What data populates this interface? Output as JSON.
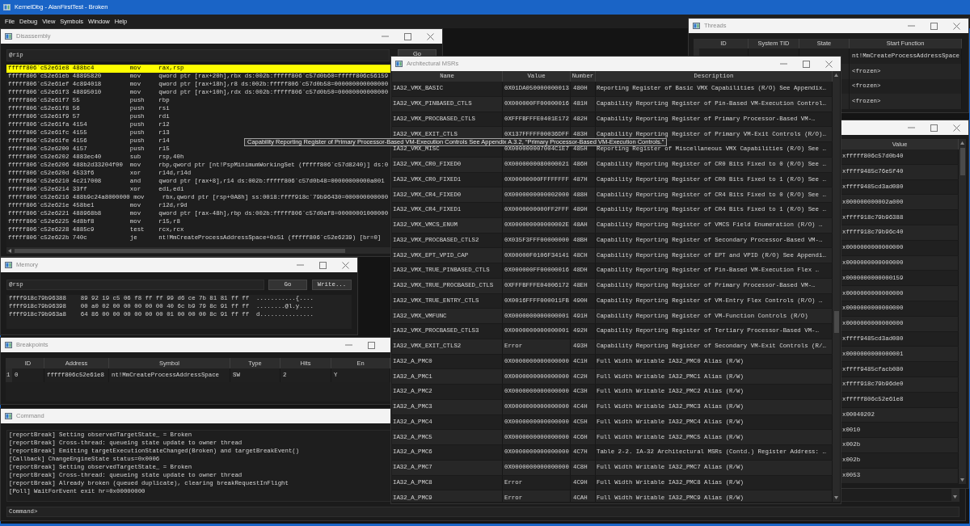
{
  "window": {
    "title": "KernelDbg - AlanFirstTest - Broken"
  },
  "menu": [
    "File",
    "Debug",
    "View",
    "Symbols",
    "Window",
    "Help"
  ],
  "disassembly": {
    "title": "Disassembly",
    "address": "@rip",
    "go_button": "Go",
    "lines": [
      {
        "address": "fffff806`c52e61e8",
        "opcode": "488bc4",
        "mnemonic": "mov",
        "operands": "rax,rsp",
        "current": true
      },
      {
        "address": "fffff806`c52e61eb",
        "opcode": "48895820",
        "mnemonic": "mov",
        "operands": "qword ptr [rax+20h],rbx ds:002b:fffff806`c57d0b60=fffff806c56159",
        "current": false
      },
      {
        "address": "fffff806`c52e61ef",
        "opcode": "4c894018",
        "mnemonic": "mov",
        "operands": "qword ptr [rax+18h],r8 ds:002b:fffff806`c57d0b58=000000000000000",
        "current": false
      },
      {
        "address": "fffff806`c52e61f3",
        "opcode": "48895010",
        "mnemonic": "mov",
        "operands": "qword ptr [rax+10h],rdx ds:002b:fffff806`c57d0b50=00000000000000",
        "current": false
      },
      {
        "address": "fffff806`c52e61f7",
        "opcode": "55",
        "mnemonic": "push",
        "operands": "rbp",
        "current": false
      },
      {
        "address": "fffff806`c52e61f8",
        "opcode": "56",
        "mnemonic": "push",
        "operands": "rsi",
        "current": false
      },
      {
        "address": "fffff806`c52e61f9",
        "opcode": "57",
        "mnemonic": "push",
        "operands": "rdi",
        "current": false
      },
      {
        "address": "fffff806`c52e61fa",
        "opcode": "4154",
        "mnemonic": "push",
        "operands": "r12",
        "current": false
      },
      {
        "address": "fffff806`c52e61fc",
        "opcode": "4155",
        "mnemonic": "push",
        "operands": "r13",
        "current": false
      },
      {
        "address": "fffff806`c52e61fe",
        "opcode": "4156",
        "mnemonic": "push",
        "operands": "r14",
        "current": false
      },
      {
        "address": "fffff806`c52e6200",
        "opcode": "4157",
        "mnemonic": "push",
        "operands": "r15",
        "current": false
      },
      {
        "address": "fffff806`c52e6202",
        "opcode": "4883ec40",
        "mnemonic": "sub",
        "operands": "rsp,40h",
        "current": false
      },
      {
        "address": "fffff806`c52e6206",
        "opcode": "488b2d33204f00",
        "mnemonic": "mov",
        "operands": "rbp,qword ptr [nt!PspMinimumWorkingSet (fffff806`c57d8240)] ds:0",
        "current": false
      },
      {
        "address": "fffff806`c52e620d",
        "opcode": "4533f6",
        "mnemonic": "xor",
        "operands": "r14d,r14d",
        "current": false
      },
      {
        "address": "fffff806`c52e6210",
        "opcode": "4c217008",
        "mnemonic": "and",
        "operands": "qword ptr [rax+8],r14 ds:002b:fffff806`c57d0b48=00000000000a001",
        "current": false
      },
      {
        "address": "fffff806`c52e6214",
        "opcode": "33ff",
        "mnemonic": "xor",
        "operands": "edi,edi",
        "current": false
      },
      {
        "address": "fffff806`c52e6216",
        "opcode": "488b9c24a8000000",
        "mnemonic": "mov",
        "operands": "rbx,qword ptr [rsp+0A8h] ss:0018:ffff918c`79b96430=000000000000",
        "current": false
      },
      {
        "address": "fffff806`c52e621e",
        "opcode": "458be1",
        "mnemonic": "mov",
        "operands": "r12d,r9d",
        "current": false
      },
      {
        "address": "fffff806`c52e6221",
        "opcode": "488968b8",
        "mnemonic": "mov",
        "operands": "qword ptr [rax-48h],rbp ds:002b:fffff806`c57d0af8=00000001000000",
        "current": false
      },
      {
        "address": "fffff806`c52e6225",
        "opcode": "4d8bf8",
        "mnemonic": "mov",
        "operands": "r15,r8",
        "current": false
      },
      {
        "address": "fffff806`c52e6228",
        "opcode": "4885c9",
        "mnemonic": "test",
        "operands": "rcx,rcx",
        "current": false
      },
      {
        "address": "fffff806`c52e622b",
        "opcode": "740c",
        "mnemonic": "je",
        "operands": "nt!MmCreateProcessAddressSpace+0x51 (fffff806`c52e6239) [br=0]",
        "current": false
      }
    ]
  },
  "threads": {
    "title": "Threads",
    "columns": [
      "ID",
      "System TID",
      "State",
      "Start Function"
    ],
    "rows": [
      {
        "start_function": "nt!MmCreateProcessAddressSpace"
      },
      {
        "start_function": "<frozen>"
      },
      {
        "start_function": "<frozen>"
      },
      {
        "start_function": "<frozen>"
      }
    ]
  },
  "registers": {
    "columns": [
      "Value"
    ],
    "values": [
      "xfffff806c57d0b40",
      "xffff9485c76e5f40",
      "xffff9485cd3ad080",
      "x000000000002a000",
      "xffff918c79b96388",
      "xffff918c79b96c40",
      "x0000000000000000",
      "x0000000000000000",
      "x0000000000000159",
      "x0000000000000000",
      "x0000000000000000",
      "x0000000000000000",
      "xffff9485cd3ad080",
      "x0000000000000001",
      "xffff9485cfacb080",
      "xffff918c79b96de0",
      "xfffff806c52e61e8",
      "x00040202",
      "x0010",
      "x002b",
      "x002b",
      "x0053"
    ]
  },
  "memory": {
    "title": "Memory",
    "address": "@rsp",
    "buttons": [
      "Go",
      "Write..."
    ],
    "lines": [
      {
        "address": "ffff918c79b96388",
        "bytes": "89 92 19 c5 06 f8 ff ff 99 d6 ce 7b 81 81 ff ff",
        "ascii": "...........{...."
      },
      {
        "address": "ffff918c79b96398",
        "bytes": "00 a0 02 00 00 00 00 00 40 6c b9 79 8c 91 ff ff",
        "ascii": "........@l.y...."
      },
      {
        "address": "ffff918c79b963a8",
        "bytes": "64 86 00 00 00 00 00 00 01 00 00 00 8c 91 ff ff",
        "ascii": "d..............."
      }
    ]
  },
  "breakpoints": {
    "title": "Breakpoints",
    "columns": [
      "ID",
      "Address",
      "Symbol",
      "Type",
      "Hits",
      "En"
    ],
    "rows": [
      {
        "row_number": "1",
        "cells": [
          "0",
          "fffff806c52e61e8",
          "nt!MmCreateProcessAddressSpace",
          "SW",
          "2",
          "Y"
        ]
      }
    ]
  },
  "command": {
    "title": "Command",
    "output": [
      "[reportBreak] Setting observedTargetState_ = Broken",
      "[reportBreak] Cross-thread: queueing state update to owner thread",
      "[reportBreak] Emitting targetExecutionStateChanged(Broken) and targetBreakEvent()",
      "[Callback] ChangeEngineState status=0x0006",
      "[reportBreak] Setting observedTargetState_ = Broken",
      "[reportBreak] Cross-thread: queueing state update to owner thread",
      "[reportBreak] Already broken (queued duplicate), clearing breakRequestInFlight",
      "[Poll] WaitForEvent exit hr=0x00000000"
    ],
    "prompt": "Command>"
  },
  "msrs": {
    "title": "Architectural MSRs",
    "columns": [
      "Name",
      "Value",
      "Number",
      "Description"
    ],
    "rows": [
      {
        "name": "IA32_VMX_BASIC",
        "value": "0X01DA050000000013",
        "number": "480H",
        "description": "Reporting Register of Basic VMX Capabilities (R/O) See Appendix…"
      },
      {
        "name": "IA32_VMX_PINBASED_CTLS",
        "value": "0X000000FF00000016",
        "number": "481H",
        "description": "Capability Reporting Register of Pin-Based VM-Execution Control…"
      },
      {
        "name": "IA32_VMX_PROCBASED_CTLS",
        "value": "0XFFFBFFFE0401E172",
        "number": "482H",
        "description": "Capability Reporting Register of Primary Processor-Based VM-…"
      },
      {
        "name": "IA32_VMX_EXIT_CTLS",
        "value": "0X137FFFFF00036DFF",
        "number": "483H",
        "description": "Capability Reporting Register of Primary VM-Exit Controls (R/O)…"
      },
      {
        "name": "IA32_VMX_MISC",
        "value": "0X000000007004C1E7",
        "number": "485H",
        "description": "Reporting Register of Miscellaneous VMX Capabilities (R/O) See …"
      },
      {
        "name": "IA32_VMX_CR0_FIXED0",
        "value": "0X0000000080000021",
        "number": "486H",
        "description": "Capability Reporting Register of CR0 Bits Fixed to 0 (R/O) See …"
      },
      {
        "name": "IA32_VMX_CR0_FIXED1",
        "value": "0X00000000FFFFFFFF",
        "number": "487H",
        "description": "Capability Reporting Register of CR0 Bits Fixed to 1 (R/O) See …"
      },
      {
        "name": "IA32_VMX_CR4_FIXED0",
        "value": "0X0000000000002000",
        "number": "488H",
        "description": "Capability Reporting Register of CR4 Bits Fixed to 0 (R/O) See …"
      },
      {
        "name": "IA32_VMX_CR4_FIXED1",
        "value": "0X0000000000FF2FFF",
        "number": "489H",
        "description": "Capability Reporting Register of CR4 Bits Fixed to 1 (R/O) See …"
      },
      {
        "name": "IA32_VMX_VMCS_ENUM",
        "value": "0X000000000000002E",
        "number": "48AH",
        "description": "Capability Reporting Register of VMCS Field Enumeration (R/O) …"
      },
      {
        "name": "IA32_VMX_PROCBASED_CTLS2",
        "value": "0X035F3FFF00000000",
        "number": "48BH",
        "description": "Capability Reporting Register of Secondary Processor-Based VM-…"
      },
      {
        "name": "IA32_VMX_EPT_VPID_CAP",
        "value": "0X00000F0106F34141",
        "number": "48CH",
        "description": "Capability Reporting Register of EPT and VPID (R/O) See Appendi…"
      },
      {
        "name": "IA32_VMX_TRUE_PINBASED_CTLS",
        "value": "0X000000FF00000016",
        "number": "48DH",
        "description": "Capability Reporting Register of Pin-Based VM-Execution Flex …"
      },
      {
        "name": "IA32_VMX_TRUE_PROCBASED_CTLS",
        "value": "0XFFFBFFFE04006172",
        "number": "48EH",
        "description": "Capability Reporting Register of Primary Processor-Based VM-…"
      },
      {
        "name": "IA32_VMX_TRUE_ENTRY_CTLS",
        "value": "0X0016FFFF000011FB",
        "number": "490H",
        "description": "Capability Reporting Register of VM-Entry Flex Controls (R/O) …"
      },
      {
        "name": "IA32_VMX_VMFUNC",
        "value": "0X0000000000000001",
        "number": "491H",
        "description": "Capability Reporting Register of VM-Function Controls (R/O)"
      },
      {
        "name": "IA32_VMX_PROCBASED_CTLS3",
        "value": "0X0000000000000001",
        "number": "492H",
        "description": "Capability Reporting Register of Tertiary Processor-Based VM-…"
      },
      {
        "name": "IA32_VMX_EXIT_CTLS2",
        "value": "Error",
        "number": "493H",
        "description": "Capability Reporting Register of Secondary VM-Exit Controls (R/…"
      },
      {
        "name": "IA32_A_PMC0",
        "value": "0X0000000000000000",
        "number": "4C1H",
        "description": "Full Width Writable IA32_PMC0 Alias (R/W)"
      },
      {
        "name": "IA32_A_PMC1",
        "value": "0X0000000000000000",
        "number": "4C2H",
        "description": "Full Width Writable IA32_PMC1 Alias (R/W)"
      },
      {
        "name": "IA32_A_PMC2",
        "value": "0X0000000000000000",
        "number": "4C3H",
        "description": "Full Width Writable IA32_PMC2 Alias (R/W)"
      },
      {
        "name": "IA32_A_PMC3",
        "value": "0X0000000000000000",
        "number": "4C4H",
        "description": "Full Width Writable IA32_PMC3 Alias (R/W)"
      },
      {
        "name": "IA32_A_PMC4",
        "value": "0X0000000000000000",
        "number": "4C5H",
        "description": "Full Width Writable IA32_PMC4 Alias (R/W)"
      },
      {
        "name": "IA32_A_PMC5",
        "value": "0X0000000000000000",
        "number": "4C6H",
        "description": "Full Width Writable IA32_PMC5 Alias (R/W)"
      },
      {
        "name": "IA32_A_PMC6",
        "value": "0X0000000000000000",
        "number": "4C7H",
        "description": "Table 2-2. IA-32 Architectural MSRs (Contd.) Register Address: …"
      },
      {
        "name": "IA32_A_PMC7",
        "value": "0X0000000000000000",
        "number": "4C8H",
        "description": "Full Width Writable IA32_PMC7 Alias (R/W)"
      },
      {
        "name": "IA32_A_PMC8",
        "value": "Error",
        "number": "4C9H",
        "description": "Full Width Writable IA32_PMC8 Alias (R/W)"
      },
      {
        "name": "IA32_A_PMC9",
        "value": "Error",
        "number": "4CAH",
        "description": "Full Width Writable IA32_PMC9 Alias (R/W)"
      }
    ]
  },
  "tooltip": "Capability Reporting Register of Primary Processor-Based VM-Execution Controls See Appendix A.3.2, “Primary Processor-Based VM-Execution Controls.”"
}
